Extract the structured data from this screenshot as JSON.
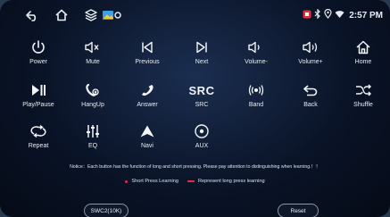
{
  "status_bar": {
    "left_icons": [
      "back-icon",
      "home-icon",
      "layers-icon",
      "image-icon",
      "location-dot-icon"
    ],
    "right_icons": [
      "app-badge-icon",
      "bluetooth-icon",
      "location-icon",
      "wifi-icon"
    ],
    "time": "2:57 PM",
    "colors": {
      "badge": "#e0303a"
    }
  },
  "buttons": [
    {
      "label": "Power",
      "icon": "power-icon"
    },
    {
      "label": "Mute",
      "icon": "mute-icon"
    },
    {
      "label": "Previous",
      "icon": "previous-icon"
    },
    {
      "label": "Next",
      "icon": "next-icon"
    },
    {
      "label": "Volume-",
      "icon": "volume-down-icon"
    },
    {
      "label": "Volume+",
      "icon": "volume-up-icon"
    },
    {
      "label": "Home",
      "icon": "home-icon"
    },
    {
      "label": "Play/Pause",
      "icon": "play-pause-icon"
    },
    {
      "label": "HangUp",
      "icon": "hang-up-icon"
    },
    {
      "label": "Answer",
      "icon": "answer-icon"
    },
    {
      "label": "SRC",
      "icon": "src-text-icon",
      "icon_text": "SRC"
    },
    {
      "label": "Band",
      "icon": "band-icon"
    },
    {
      "label": "Back",
      "icon": "back-icon"
    },
    {
      "label": "Shuffle",
      "icon": "shuffle-icon"
    },
    {
      "label": "Repeat",
      "icon": "repeat-icon"
    },
    {
      "label": "EQ",
      "icon": "eq-icon"
    },
    {
      "label": "Navi",
      "icon": "navi-icon"
    },
    {
      "label": "AUX",
      "icon": "aux-icon"
    }
  ],
  "notice": "Notice：Each button has the function of long and short pressing. Please pay attention to distinguishing when learning.！！",
  "legend": {
    "short": "Short Press Learning",
    "long": "Represent long press learning",
    "color": "#e0303a"
  },
  "footer": {
    "mode_button": "SWC2(10K)",
    "reset_button": "Reset"
  }
}
